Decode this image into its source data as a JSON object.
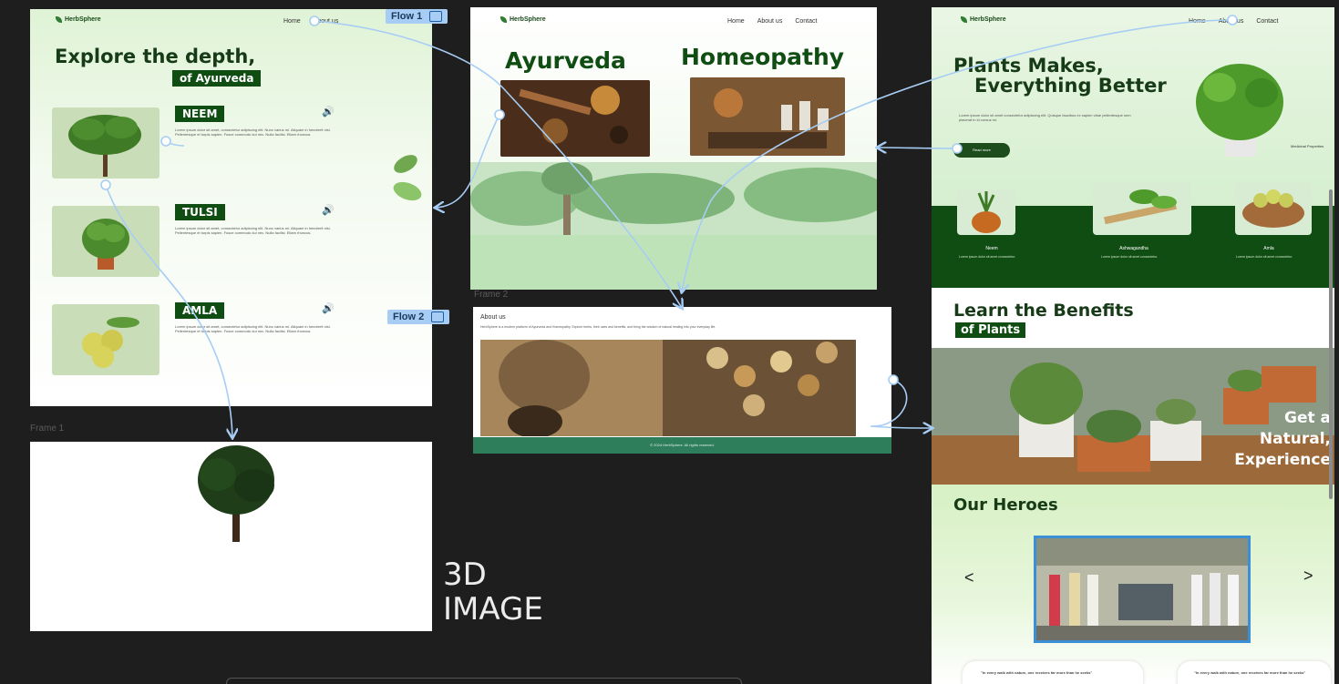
{
  "flows": {
    "flow1": "Flow 1",
    "flow2": "Flow 2"
  },
  "frame_labels": {
    "frame1": "Frame 1",
    "frame2": "Frame 2"
  },
  "canvas_text": {
    "line1": "3D",
    "line2": "IMAGE"
  },
  "frame1": {
    "logo": "HerbSphere",
    "nav": [
      "Home",
      "About us",
      "Contact"
    ],
    "heading": "Explore the depth,",
    "subheading": "of Ayurveda",
    "herbs": [
      {
        "name": "NEEM",
        "text": "Lorem ipsum dolor sit amet, consectetur adipiscing elit. Nunc varius mi. Aliquam in hendrerit nisi. Pellentesque et turpis sapien. Fusce commodo dui nec. Nulla facilisi. Etiam rhoncus."
      },
      {
        "name": "TULSI",
        "text": "Lorem ipsum dolor sit amet, consectetur adipiscing elit. Nunc varius mi. Aliquam in hendrerit nisi. Pellentesque et turpis sapien. Fusce commodo dui nec. Nulla facilisi. Etiam rhoncus."
      },
      {
        "name": "AMLA",
        "text": "Lorem ipsum dolor sit amet, consectetur adipiscing elit. Nunc varius mi. Aliquam in hendrerit nisi. Pellentesque et turpis sapien. Fusce commodo dui nec. Nulla facilisi. Etiam rhoncus."
      }
    ],
    "speaker_icon": "speaker-icon"
  },
  "frame_center": {
    "logo": "HerbSphere",
    "nav": [
      "Home",
      "About us",
      "Contact"
    ],
    "title_left": "Ayurveda",
    "title_right": "Homeopathy"
  },
  "frame2": {
    "heading": "About us",
    "text": "HerbSphere is a modern platform of Ayurveda and Homeopathy. Explore herbs, their uses and benefits, and bring the wisdom of natural healing into your everyday life.",
    "footer": "© 2024 HerbSphere. All rights reserved."
  },
  "frame_right": {
    "logo": "HerbSphere",
    "nav": [
      "Home",
      "About us",
      "Contact"
    ],
    "hero_title_1": "Plants Makes,",
    "hero_title_2": "Everything Better",
    "hero_text": "Lorem ipsum dolor sit amet consectetur adipiscing elit. Quisque faucibus ex sapien vitae pellentesque sem placerat in id cursus mi.",
    "button": "Read more",
    "plant_caption": "Medicinal Properties",
    "cards": [
      {
        "title": "Neem",
        "text": "Lorem ipsum dolor sit amet consectetur."
      },
      {
        "title": "Ashwagandha",
        "text": "Lorem ipsum dolor sit amet consectetur."
      },
      {
        "title": "Amla",
        "text": "Lorem ipsum dolor sit amet consectetur."
      }
    ],
    "learn_title_1": "Learn the Benefits",
    "learn_title_2": "of Plants",
    "overlay": [
      "Get a",
      "Natural,",
      "Experience"
    ],
    "heroes_title": "Our Heroes",
    "carousel_prev": "<",
    "carousel_next": ">",
    "quote": "\"In every walk with nature, one receives far more than he seeks\""
  },
  "colors": {
    "dark_green": "#0f4d12",
    "flow_blue": "#a7cdf5",
    "canvas": "#1e1e1e",
    "teal_footer": "#2e7d5b"
  }
}
